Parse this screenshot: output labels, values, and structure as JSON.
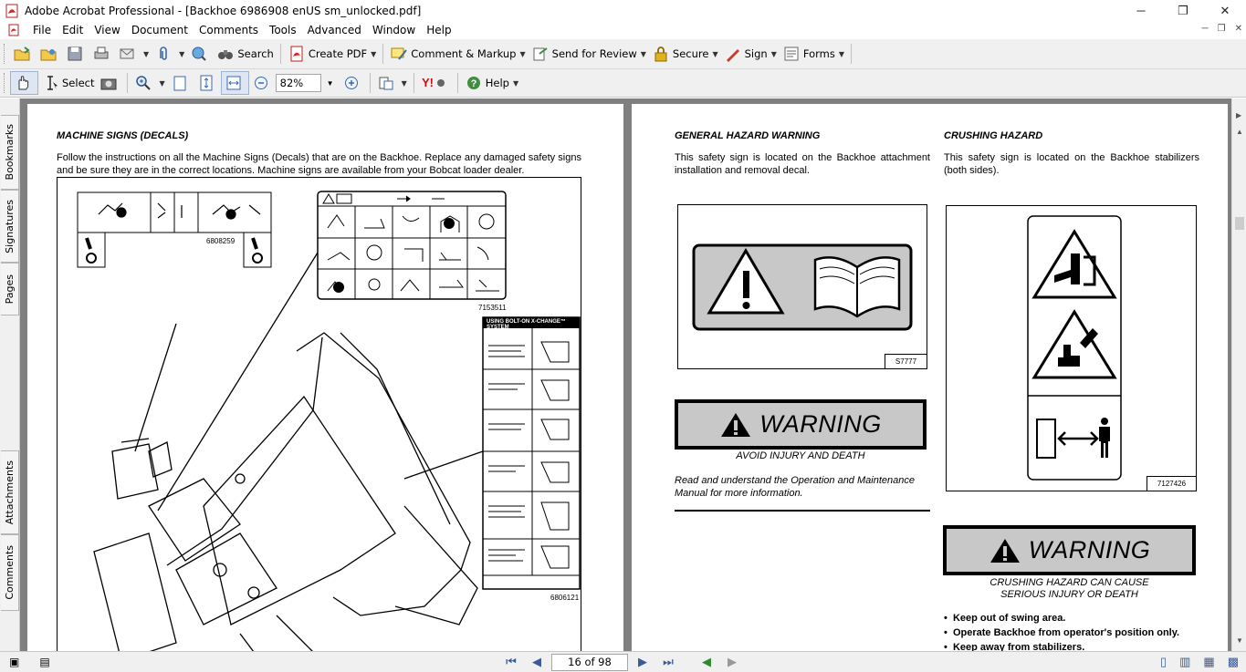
{
  "window": {
    "title": "Adobe Acrobat Professional - [Backhoe 6986908 enUS sm_unlocked.pdf]",
    "minimize": "─",
    "restore": "❐",
    "close": "✕"
  },
  "menu": [
    "File",
    "Edit",
    "View",
    "Document",
    "Comments",
    "Tools",
    "Advanced",
    "Window",
    "Help"
  ],
  "toolbar1": {
    "search": "Search",
    "create_pdf": "Create PDF",
    "comment_markup": "Comment & Markup",
    "send_review": "Send for Review",
    "secure": "Secure",
    "sign": "Sign",
    "forms": "Forms"
  },
  "toolbar2": {
    "select": "Select",
    "zoom_value": "82%",
    "help": "Help"
  },
  "side_tabs": [
    "Bookmarks",
    "Signatures",
    "Pages",
    "Attachments",
    "Comments"
  ],
  "left_page": {
    "heading": "MACHINE SIGNS (DECALS)",
    "intro": "Follow the instructions on all the Machine Signs (Decals) that are on the Backhoe. Replace any damaged safety signs and be sure they are in the correct locations. Machine signs are available from your Bobcat loader dealer.",
    "decal_1": "6808259",
    "decal_2": "7153511",
    "decal_3": "6806121",
    "decal_3_title": "USING BOLT-ON X-CHANGE™ SYSTEM"
  },
  "right_page": {
    "col1": {
      "heading": "GENERAL HAZARD WARNING",
      "text": "This safety sign is located on the Backhoe attachment installation and removal decal.",
      "decal": "S7777",
      "warning_word": "WARNING",
      "warning_caption": "AVOID INJURY AND DEATH",
      "read_text": "Read and understand the Operation and Maintenance Manual for more information."
    },
    "col2": {
      "heading": "CRUSHING HAZARD",
      "text": "This safety sign is located on the Backhoe stabilizers (both sides).",
      "decal": "7127426",
      "warning_word": "WARNING",
      "warning_caption_1": "CRUSHING HAZARD CAN CAUSE",
      "warning_caption_2": "SERIOUS INJURY OR DEATH",
      "bullets": [
        "Keep out of swing area.",
        "Operate Backhoe from operator's position only.",
        "Keep away from stabilizers."
      ]
    }
  },
  "status": {
    "page_indicator": "16 of 98"
  },
  "colors": {
    "toolbar_bg": "#f0f0f0",
    "viewport_bg": "#808080",
    "warning_bg": "#c8c8c8"
  }
}
